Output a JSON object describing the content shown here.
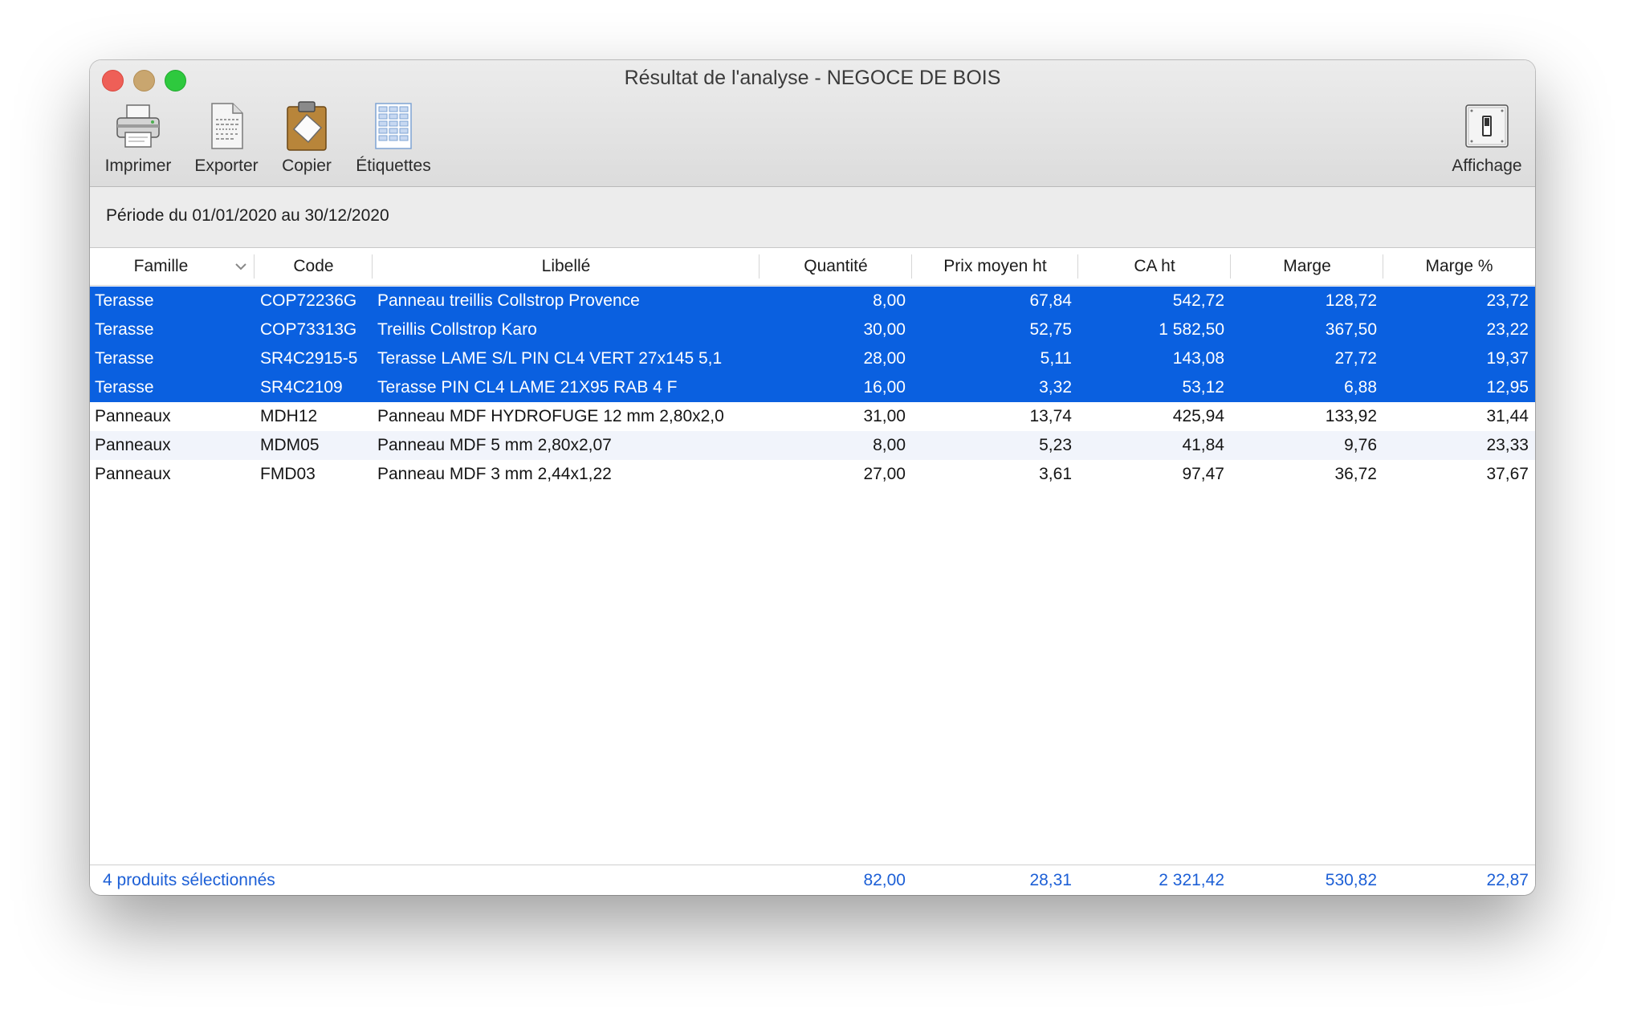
{
  "window": {
    "title": "Résultat de l'analyse - NEGOCE DE BOIS"
  },
  "toolbar": {
    "print_label": "Imprimer",
    "export_label": "Exporter",
    "copy_label": "Copier",
    "labels_label": "Étiquettes",
    "display_label": "Affichage"
  },
  "period": {
    "text": "Période du 01/01/2020 au 30/12/2020"
  },
  "table": {
    "headers": [
      "Famille",
      "Code",
      "Libellé",
      "Quantité",
      "Prix moyen ht",
      "CA ht",
      "Marge",
      "Marge %"
    ],
    "rows": [
      {
        "famille": "Terasse",
        "code": "COP72236G",
        "libelle": "Panneau treillis Collstrop Provence",
        "quantite": "8,00",
        "prix": "67,84",
        "ca": "542,72",
        "marge": "128,72",
        "marge_pct": "23,72",
        "selected": true
      },
      {
        "famille": "Terasse",
        "code": "COP73313G",
        "libelle": "Treillis Collstrop Karo",
        "quantite": "30,00",
        "prix": "52,75",
        "ca": "1 582,50",
        "marge": "367,50",
        "marge_pct": "23,22",
        "selected": true
      },
      {
        "famille": "Terasse",
        "code": "SR4C2915-5",
        "libelle": "Terasse LAME S/L PIN CL4 VERT 27x145 5,1",
        "quantite": "28,00",
        "prix": "5,11",
        "ca": "143,08",
        "marge": "27,72",
        "marge_pct": "19,37",
        "selected": true
      },
      {
        "famille": "Terasse",
        "code": "SR4C2109",
        "libelle": "Terasse PIN CL4 LAME 21X95 RAB 4 F",
        "quantite": "16,00",
        "prix": "3,32",
        "ca": "53,12",
        "marge": "6,88",
        "marge_pct": "12,95",
        "selected": true
      },
      {
        "famille": "Panneaux",
        "code": "MDH12",
        "libelle": "Panneau MDF HYDROFUGE 12 mm 2,80x2,0",
        "quantite": "31,00",
        "prix": "13,74",
        "ca": "425,94",
        "marge": "133,92",
        "marge_pct": "31,44",
        "selected": false
      },
      {
        "famille": "Panneaux",
        "code": "MDM05",
        "libelle": "Panneau MDF 5 mm 2,80x2,07",
        "quantite": "8,00",
        "prix": "5,23",
        "ca": "41,84",
        "marge": "9,76",
        "marge_pct": "23,33",
        "selected": false
      },
      {
        "famille": "Panneaux",
        "code": "FMD03",
        "libelle": "Panneau MDF 3 mm 2,44x1,22",
        "quantite": "27,00",
        "prix": "3,61",
        "ca": "97,47",
        "marge": "36,72",
        "marge_pct": "37,67",
        "selected": false
      }
    ]
  },
  "footer": {
    "selection_text": "4 produits sélectionnés",
    "quantite": "82,00",
    "prix": "28,31",
    "ca": "2 321,42",
    "marge": "530,82",
    "marge_pct": "22,87"
  },
  "colors": {
    "selection": "#0a60e0",
    "footer_text": "#1c5fd6",
    "close": "#ee5f57",
    "minimize": "#c9a66f",
    "zoom": "#2ec93e"
  },
  "icons": [
    "printer-icon",
    "export-document-icon",
    "clipboard-icon",
    "labels-grid-icon",
    "display-toggle-icon",
    "chevron-down-icon"
  ]
}
